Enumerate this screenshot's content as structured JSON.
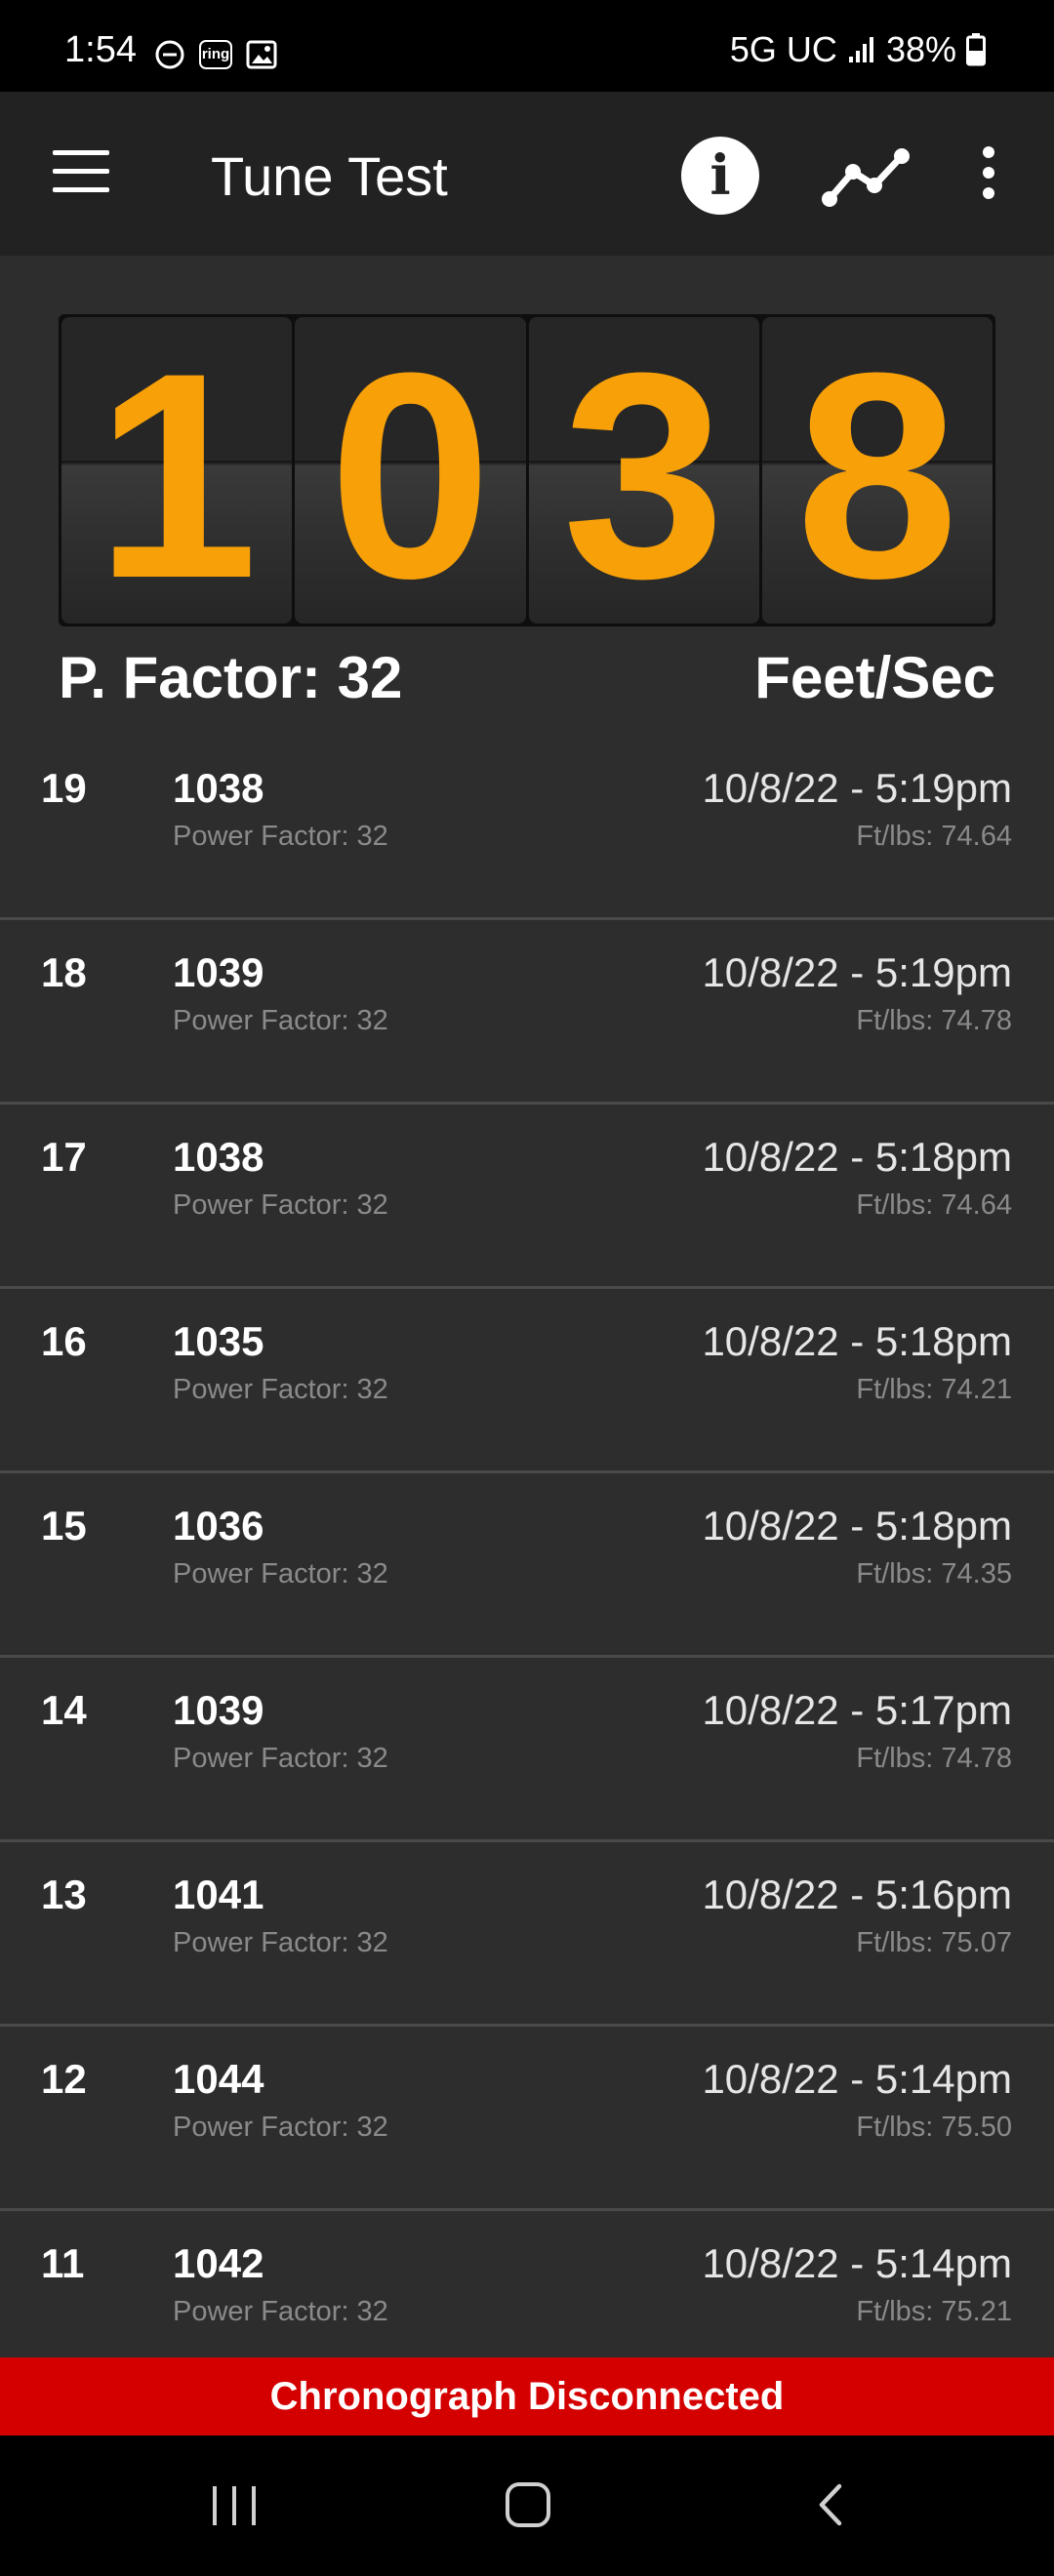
{
  "status_bar": {
    "time": "1:54",
    "network": "5G UC",
    "battery": "38%",
    "icons": [
      "do-not-disturb-icon",
      "ring-icon",
      "image-icon",
      "signal-icon",
      "battery-icon"
    ]
  },
  "app_bar": {
    "title": "Tune Test",
    "icons": [
      "menu-icon",
      "info-icon",
      "graph-icon",
      "more-vert-icon"
    ]
  },
  "display": {
    "digits": [
      "1",
      "0",
      "3",
      "8"
    ],
    "power_factor_label": "P. Factor: 32",
    "unit": "Feet/Sec",
    "digit_color": "#f7a008"
  },
  "shots": [
    {
      "num": "19",
      "velocity": "1038",
      "power_factor": "Power Factor: 32",
      "datetime": "10/8/22 - 5:19pm",
      "energy": "Ft/lbs: 74.64"
    },
    {
      "num": "18",
      "velocity": "1039",
      "power_factor": "Power Factor: 32",
      "datetime": "10/8/22 - 5:19pm",
      "energy": "Ft/lbs: 74.78"
    },
    {
      "num": "17",
      "velocity": "1038",
      "power_factor": "Power Factor: 32",
      "datetime": "10/8/22 - 5:18pm",
      "energy": "Ft/lbs: 74.64"
    },
    {
      "num": "16",
      "velocity": "1035",
      "power_factor": "Power Factor: 32",
      "datetime": "10/8/22 - 5:18pm",
      "energy": "Ft/lbs: 74.21"
    },
    {
      "num": "15",
      "velocity": "1036",
      "power_factor": "Power Factor: 32",
      "datetime": "10/8/22 - 5:18pm",
      "energy": "Ft/lbs: 74.35"
    },
    {
      "num": "14",
      "velocity": "1039",
      "power_factor": "Power Factor: 32",
      "datetime": "10/8/22 - 5:17pm",
      "energy": "Ft/lbs: 74.78"
    },
    {
      "num": "13",
      "velocity": "1041",
      "power_factor": "Power Factor: 32",
      "datetime": "10/8/22 - 5:16pm",
      "energy": "Ft/lbs: 75.07"
    },
    {
      "num": "12",
      "velocity": "1044",
      "power_factor": "Power Factor: 32",
      "datetime": "10/8/22 - 5:14pm",
      "energy": "Ft/lbs: 75.50"
    },
    {
      "num": "11",
      "velocity": "1042",
      "power_factor": "Power Factor: 32",
      "datetime": "10/8/22 - 5:14pm",
      "energy": "Ft/lbs: 75.21"
    }
  ],
  "banner": {
    "text": "Chronograph Disconnected",
    "color": "#d40000"
  },
  "nav_bar": {
    "icons": [
      "recent-apps-icon",
      "home-icon",
      "back-icon"
    ]
  }
}
